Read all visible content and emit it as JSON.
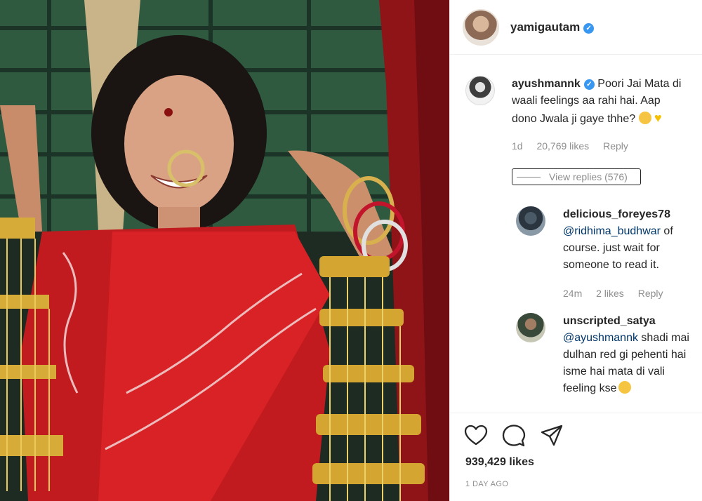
{
  "post": {
    "owner": {
      "username": "yamigautam",
      "verified": true
    },
    "likes": "939,429 likes",
    "time_ago": "1 DAY AGO"
  },
  "comments": [
    {
      "username": "ayushmannk",
      "verified": true,
      "text_line1": "Poori Jai Mata di",
      "text_line2": "waali feelings aa rahi hai. Aap",
      "text_line3": "dono Jwala ji gaye thhe?",
      "age": "1d",
      "likes": "20,769 likes",
      "reply": "Reply",
      "view_replies": "View replies (576)"
    }
  ],
  "replies": [
    {
      "username": "delicious_foreyes78",
      "mention": "@ridhima_budhwar",
      "text_after_mention": " of",
      "text_line2": "course. just wait for",
      "text_line3": "someone to read it.",
      "age": "24m",
      "likes": "2 likes",
      "reply": "Reply"
    },
    {
      "username": "unscripted_satya",
      "mention": "@ayushmannk",
      "text_after_mention": " shadi mai",
      "text_line2": "dulhan red gi pehenti hai",
      "text_line3": "isme hai mata di vali",
      "text_line4": "feeling kse"
    }
  ],
  "icons": [
    "heart-icon",
    "comment-icon",
    "share-icon",
    "verified-icon"
  ],
  "colors": {
    "mention": "#00376b",
    "verified": "#3897f0",
    "muted": "#8e8e8e"
  }
}
